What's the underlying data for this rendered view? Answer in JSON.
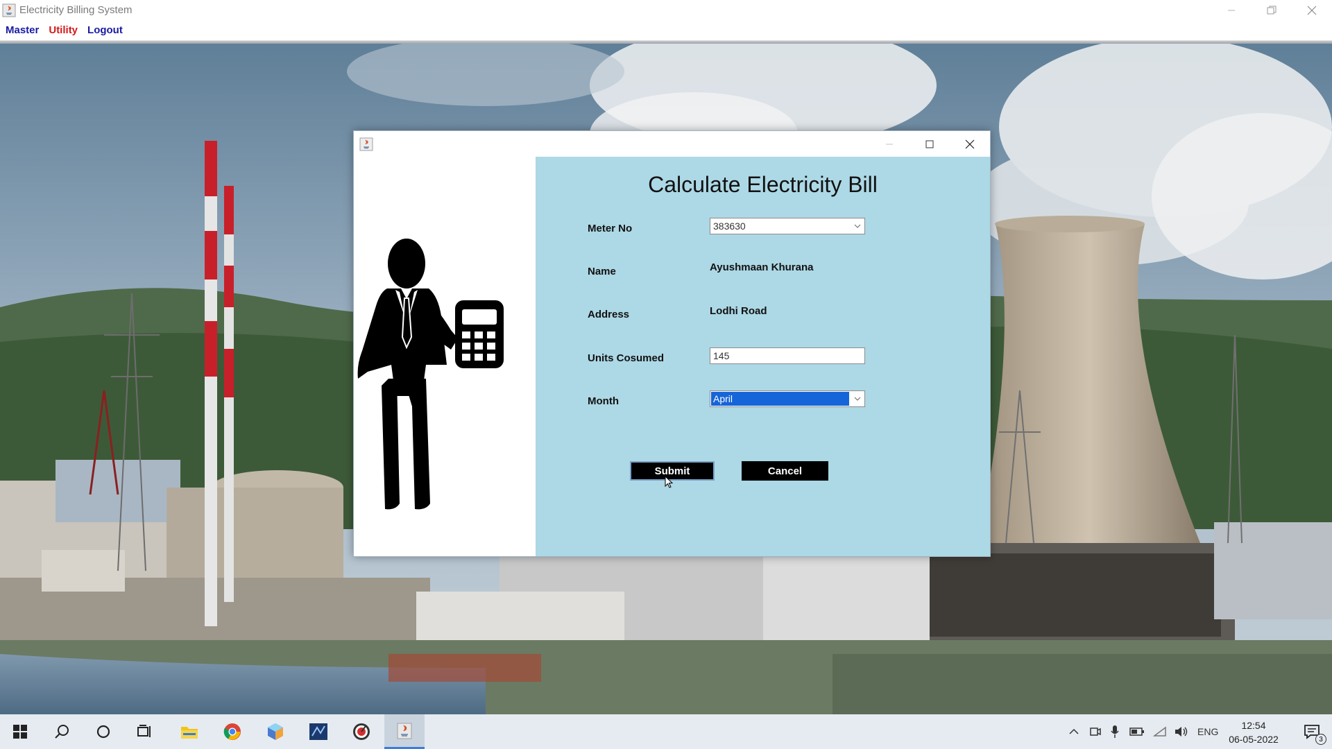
{
  "window": {
    "title": "Electricity Billing System",
    "menu": [
      {
        "label": "Master",
        "color": "#1a1aa6"
      },
      {
        "label": "Utility",
        "color": "#d41a1a"
      },
      {
        "label": "Logout",
        "color": "#1a1aa6"
      }
    ]
  },
  "dialog": {
    "heading": "Calculate Electricity Bill",
    "fields": {
      "meter_no": {
        "label": "Meter No",
        "value": "383630"
      },
      "name": {
        "label": "Name",
        "value": "Ayushmaan Khurana"
      },
      "address": {
        "label": "Address",
        "value": "Lodhi Road"
      },
      "units": {
        "label": "Units Cosumed",
        "value": "145"
      },
      "month": {
        "label": "Month",
        "value": "April"
      }
    },
    "buttons": {
      "submit": "Submit",
      "cancel": "Cancel"
    },
    "panel_color": "#add8e6"
  },
  "taskbar": {
    "language": "ENG",
    "time": "12:54",
    "date": "06-05-2022",
    "notification_count": "3"
  }
}
